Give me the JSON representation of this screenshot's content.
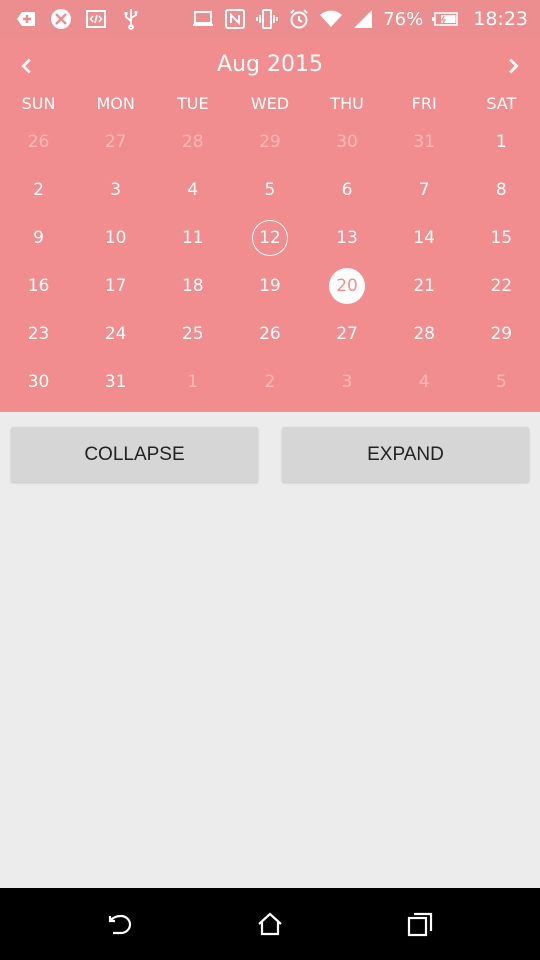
{
  "status_bar": {
    "left_icons": [
      "add-alert-icon",
      "crossed-circle-icon",
      "code-icon",
      "usb-icon"
    ],
    "right_icons": [
      "laptop-icon",
      "nfc-icon",
      "vibrate-icon",
      "alarm-icon",
      "wifi-icon",
      "signal-icon"
    ],
    "battery_percent": "76%",
    "time": "18:23"
  },
  "calendar": {
    "month_title": "Aug 2015",
    "prev_icon": "chevron-left-icon",
    "next_icon": "chevron-right-icon",
    "weekdays": [
      "SUN",
      "MON",
      "TUE",
      "WED",
      "THU",
      "FRI",
      "SAT"
    ],
    "weeks": [
      [
        {
          "d": "26",
          "m": true
        },
        {
          "d": "27",
          "m": true
        },
        {
          "d": "28",
          "m": true
        },
        {
          "d": "29",
          "m": true
        },
        {
          "d": "30",
          "m": true
        },
        {
          "d": "31",
          "m": true
        },
        {
          "d": "1"
        }
      ],
      [
        {
          "d": "2"
        },
        {
          "d": "3"
        },
        {
          "d": "4"
        },
        {
          "d": "5"
        },
        {
          "d": "6"
        },
        {
          "d": "7"
        },
        {
          "d": "8"
        }
      ],
      [
        {
          "d": "9"
        },
        {
          "d": "10"
        },
        {
          "d": "11"
        },
        {
          "d": "12",
          "today": true
        },
        {
          "d": "13"
        },
        {
          "d": "14"
        },
        {
          "d": "15"
        }
      ],
      [
        {
          "d": "16"
        },
        {
          "d": "17"
        },
        {
          "d": "18"
        },
        {
          "d": "19"
        },
        {
          "d": "20",
          "selected": true
        },
        {
          "d": "21"
        },
        {
          "d": "22"
        }
      ],
      [
        {
          "d": "23"
        },
        {
          "d": "24"
        },
        {
          "d": "25"
        },
        {
          "d": "26"
        },
        {
          "d": "27"
        },
        {
          "d": "28"
        },
        {
          "d": "29"
        }
      ],
      [
        {
          "d": "30"
        },
        {
          "d": "31"
        },
        {
          "d": "1",
          "m": true
        },
        {
          "d": "2",
          "m": true
        },
        {
          "d": "3",
          "m": true
        },
        {
          "d": "4",
          "m": true
        },
        {
          "d": "5",
          "m": true
        }
      ]
    ],
    "colors": {
      "background": "#f28d8f",
      "text": "#ffffff",
      "muted_text": "#f6b8b9",
      "selected_bg": "#ffffff"
    }
  },
  "actions": {
    "collapse_label": "COLLAPSE",
    "expand_label": "EXPAND"
  },
  "nav_bar": {
    "icons": [
      "back-icon",
      "home-icon",
      "recent-apps-icon"
    ]
  }
}
